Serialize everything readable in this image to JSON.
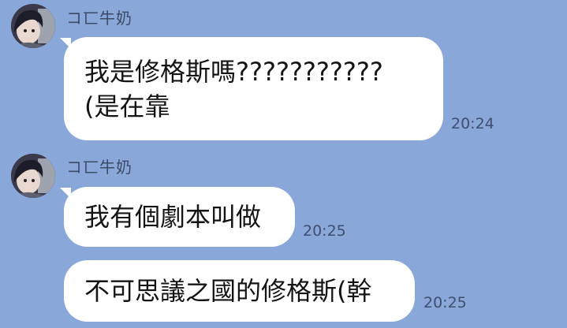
{
  "messages": [
    {
      "sender": "コ匸牛奶",
      "lines": [
        "我是修格斯嗎???????????",
        "(是在靠"
      ],
      "time": "20:24"
    },
    {
      "sender": "コ匸牛奶",
      "lines": [
        "我有個劇本叫做"
      ],
      "time": "20:25"
    },
    {
      "lines": [
        "不可思議之國的修格斯(幹"
      ],
      "time": "20:25"
    }
  ],
  "colors": {
    "background": "#8aa7d9",
    "bubble": "#ffffff",
    "sender_text": "#3b4b68",
    "time_text": "#3f4f6f"
  },
  "icons": {
    "avatar": "user-avatar-anime-portrait"
  }
}
